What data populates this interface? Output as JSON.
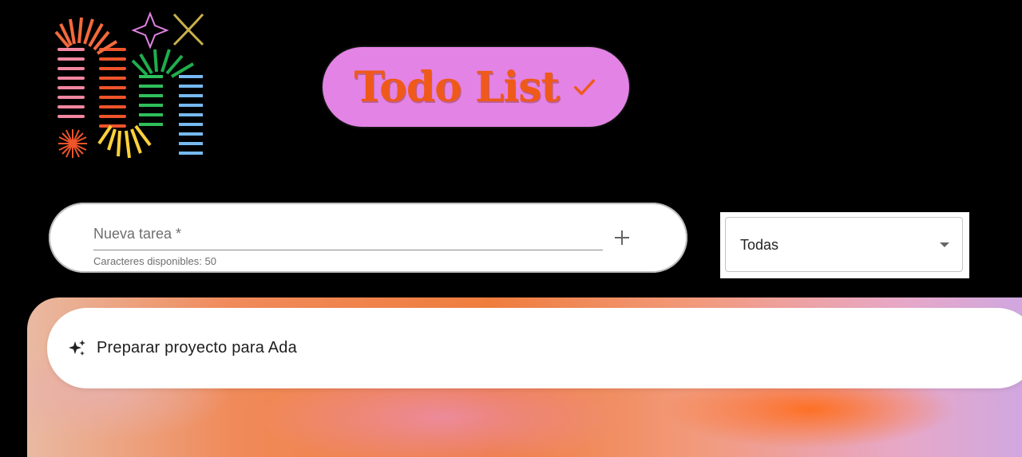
{
  "header": {
    "title": "Todo List",
    "check_icon": "check-icon",
    "colors": {
      "pill": "#e383e5",
      "title": "#ef5a1a"
    }
  },
  "logo": {
    "icon": "springs-logo"
  },
  "new_task": {
    "label": "Nueva tarea *",
    "helper": "Caracteres disponibles: 50",
    "add_icon": "plus-icon"
  },
  "filter": {
    "selected": "Todas",
    "arrow_icon": "dropdown-arrow-icon"
  },
  "tasks": [
    {
      "text": "Preparar proyecto para Ada",
      "icon": "sparkle-icon"
    }
  ]
}
